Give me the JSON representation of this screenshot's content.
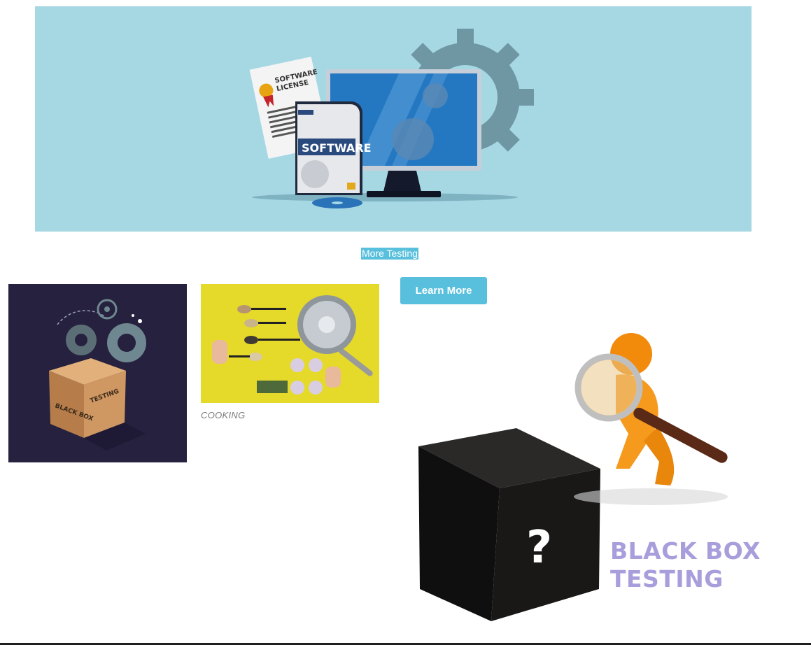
{
  "hero": {
    "license_text_line1": "SOFTWARE",
    "license_text_line2": "LICENSE",
    "box_label": "SOFTWARE"
  },
  "links": {
    "more_testing": "More Testing"
  },
  "buttons": {
    "learn_more": "Learn More"
  },
  "tiles": {
    "dark_box_text_1": "BLACK BOX",
    "dark_box_text_2": "TESTING",
    "cooking_caption": "COOKING"
  },
  "blackbox": {
    "label_line1": "BLACK BOX",
    "label_line2": "TESTING",
    "question_mark": "?"
  },
  "colors": {
    "accent": "#58bfdd",
    "hero_bg": "#a6d8e4",
    "label": "#a99edc"
  }
}
